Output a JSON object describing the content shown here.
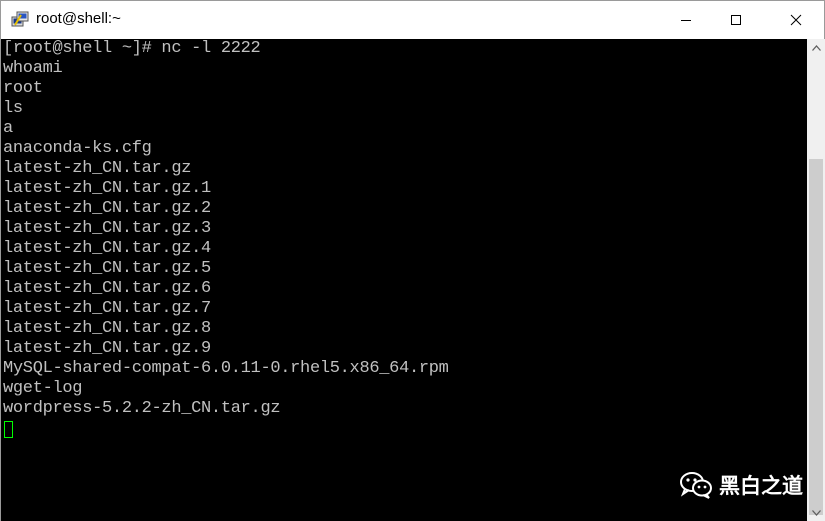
{
  "window": {
    "title": "root@shell:~"
  },
  "icons": {
    "app": "putty-icon",
    "minimize": "minimize-icon",
    "maximize": "maximize-icon",
    "close": "close-icon",
    "scroll_up": "arrow-up-icon",
    "scroll_down": "arrow-down-icon",
    "watermark": "wechat-icon"
  },
  "terminal": {
    "lines": [
      "[root@shell ~]# nc -l 2222",
      "whoami",
      "root",
      "ls",
      "a",
      "anaconda-ks.cfg",
      "latest-zh_CN.tar.gz",
      "latest-zh_CN.tar.gz.1",
      "latest-zh_CN.tar.gz.2",
      "latest-zh_CN.tar.gz.3",
      "latest-zh_CN.tar.gz.4",
      "latest-zh_CN.tar.gz.5",
      "latest-zh_CN.tar.gz.6",
      "latest-zh_CN.tar.gz.7",
      "latest-zh_CN.tar.gz.8",
      "latest-zh_CN.tar.gz.9",
      "MySQL-shared-compat-6.0.11-0.rhel5.x86_64.rpm",
      "wget-log",
      "wordpress-5.2.2-zh_CN.tar.gz"
    ],
    "text_color": "#c0c0c0",
    "background": "#000000",
    "cursor_color": "#00ff00"
  },
  "watermark": {
    "text": "黑白之道"
  }
}
